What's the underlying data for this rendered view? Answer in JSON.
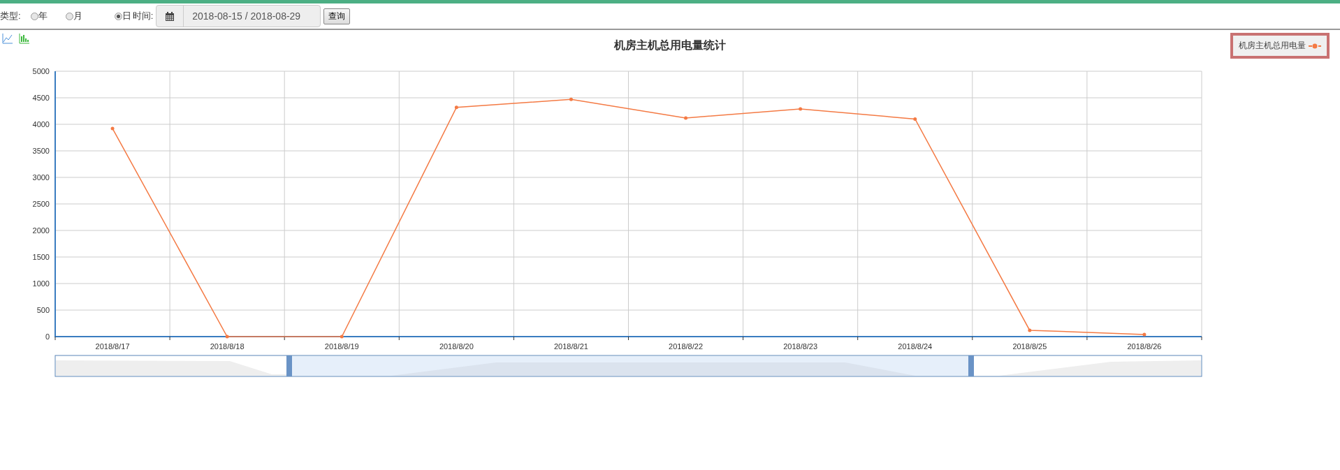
{
  "filter_bar": {
    "type_label": "类型:",
    "options": [
      {
        "label": "年",
        "selected": false
      },
      {
        "label": "月",
        "selected": false
      },
      {
        "label": "日",
        "selected": true
      }
    ],
    "time_label": "时间:",
    "date_range": "2018-08-15 / 2018-08-29",
    "query_button": "查询"
  },
  "chart": {
    "chart_data": {
      "type": "line",
      "title": "机房主机总用电量统计",
      "categories": [
        "2018/8/17",
        "2018/8/18",
        "2018/8/19",
        "2018/8/20",
        "2018/8/21",
        "2018/8/22",
        "2018/8/23",
        "2018/8/24",
        "2018/8/25",
        "2018/8/26"
      ],
      "series": [
        {
          "name": "机房主机总用电量",
          "color": "#f47a44",
          "values": [
            3920,
            0,
            0,
            4320,
            4470,
            4120,
            4290,
            4100,
            120,
            40
          ]
        }
      ],
      "grid": true,
      "ylim": [
        0,
        5000
      ],
      "yticks": [
        0,
        500,
        1000,
        1500,
        2000,
        2500,
        3000,
        3500,
        4000,
        4500,
        5000
      ]
    }
  }
}
